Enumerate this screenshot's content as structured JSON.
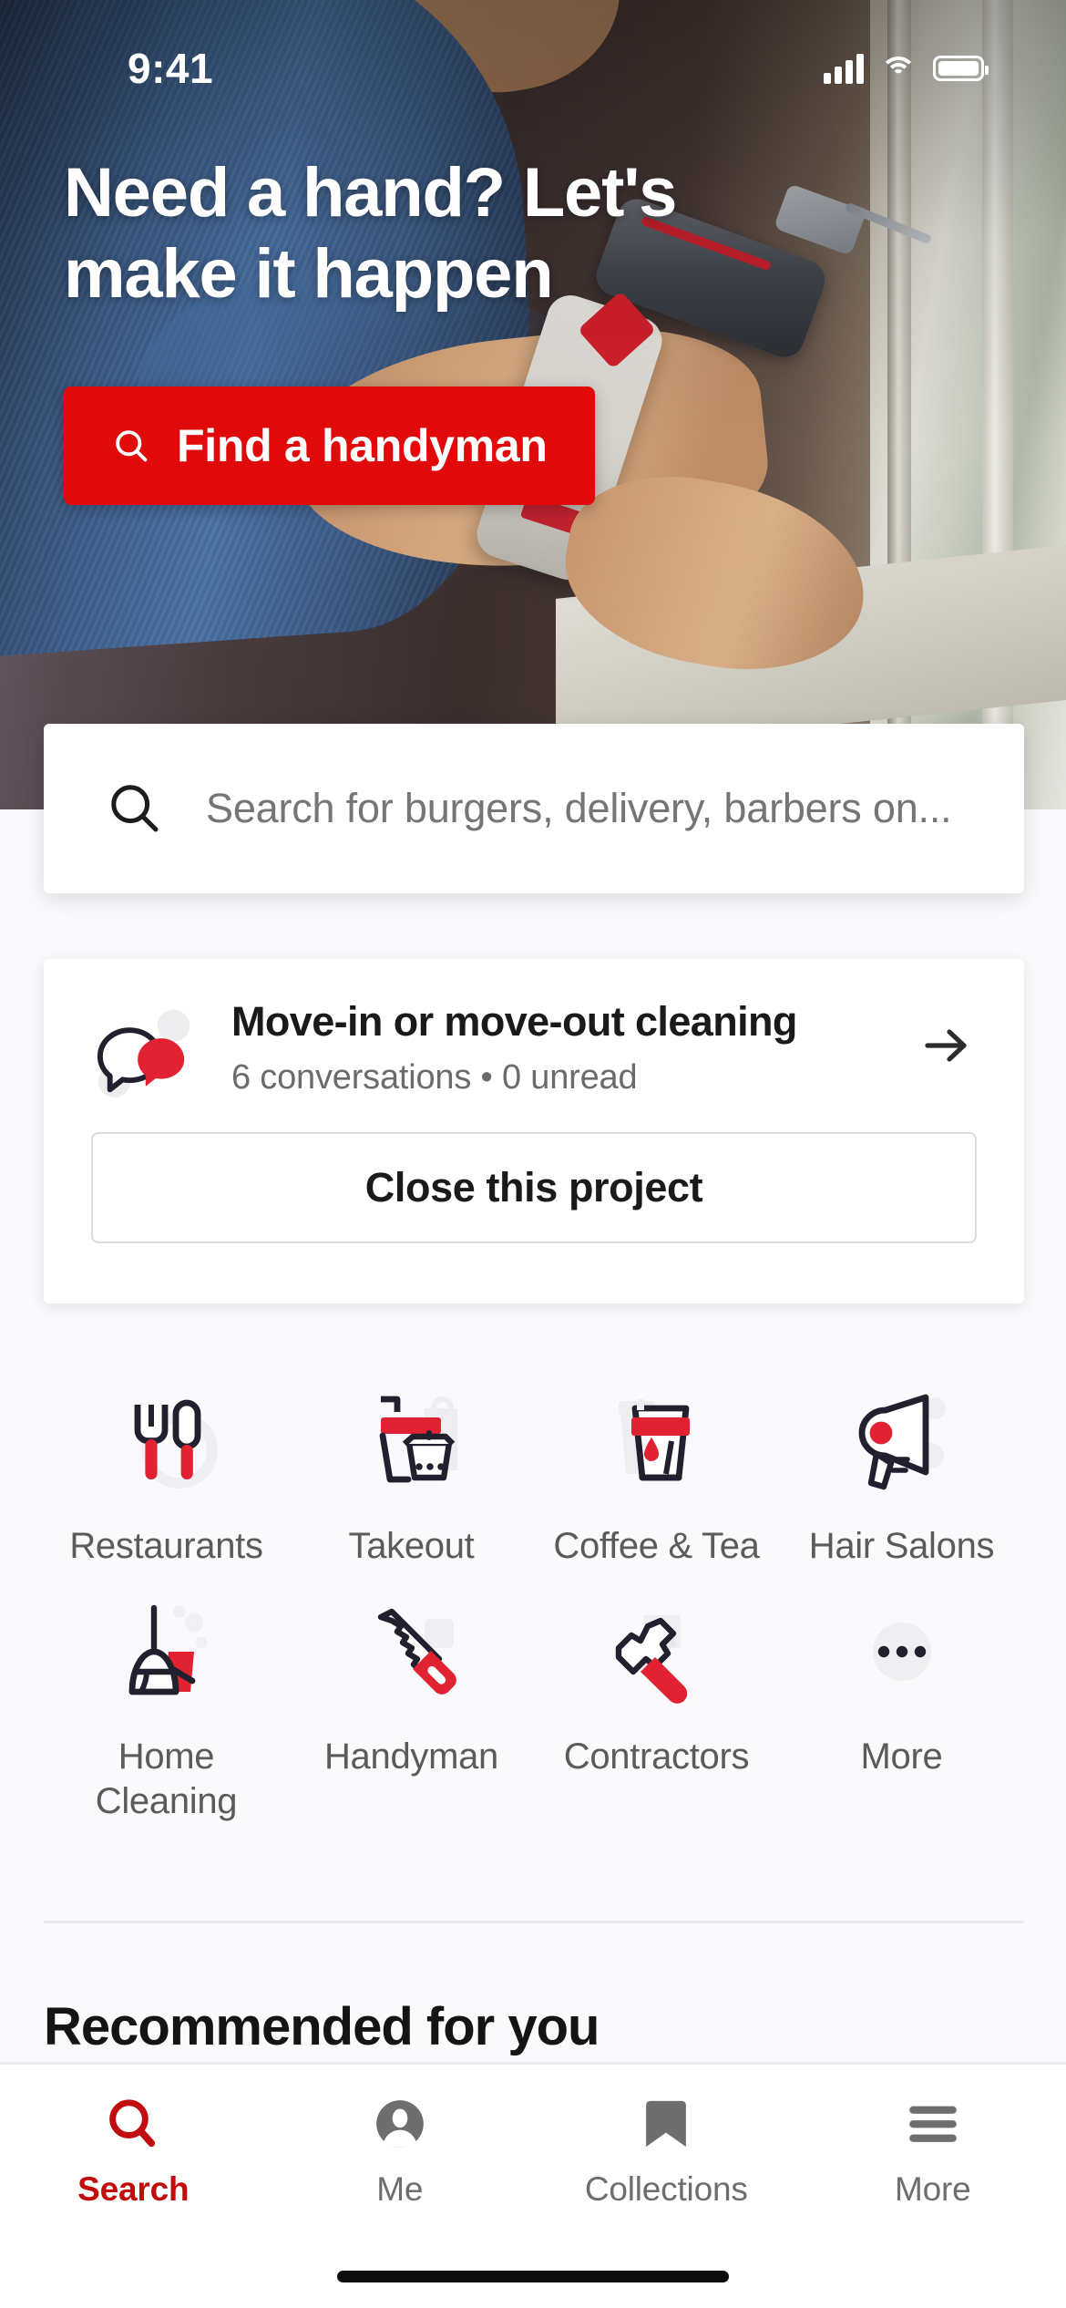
{
  "status_bar": {
    "time": "9:41",
    "cellular_icon": "signal-bars-icon",
    "wifi_icon": "wifi-icon",
    "battery_icon": "battery-icon"
  },
  "hero": {
    "title": "Need a hand? Let's make it happen",
    "cta_label": "Find a handyman",
    "cta_icon": "search-icon",
    "cta_color": "#E10A0A"
  },
  "search": {
    "icon": "search-icon",
    "placeholder": "Search for burgers, delivery, barbers on..."
  },
  "project_card": {
    "icon": "chat-bubbles-icon",
    "title": "Move-in or move-out cleaning",
    "subtitle": "6 conversations • 0 unread",
    "arrow_icon": "arrow-right-icon",
    "close_button_label": "Close this project"
  },
  "categories": [
    {
      "label": "Restaurants",
      "icon": "fork-knife-icon"
    },
    {
      "label": "Takeout",
      "icon": "takeout-box-icon"
    },
    {
      "label": "Coffee & Tea",
      "icon": "coffee-cup-icon"
    },
    {
      "label": "Hair Salons",
      "icon": "hair-dryer-icon"
    },
    {
      "label": "Home Cleaning",
      "icon": "broom-dustpan-icon"
    },
    {
      "label": "Handyman",
      "icon": "handsaw-icon"
    },
    {
      "label": "Contractors",
      "icon": "hammer-icon"
    },
    {
      "label": "More",
      "icon": "ellipsis-icon"
    }
  ],
  "sections": {
    "recommended_title": "Recommended for you"
  },
  "tab_bar": {
    "active": "Search",
    "accent_color": "#C10D0D",
    "items": [
      {
        "label": "Search",
        "icon": "search-icon"
      },
      {
        "label": "Me",
        "icon": "person-avatar-icon"
      },
      {
        "label": "Collections",
        "icon": "bookmark-icon"
      },
      {
        "label": "More",
        "icon": "hamburger-menu-icon"
      }
    ]
  },
  "theme": {
    "brand_red": "#D8202C",
    "dark_navy": "#2B2B3D",
    "page_bg": "#FAFAFC"
  }
}
